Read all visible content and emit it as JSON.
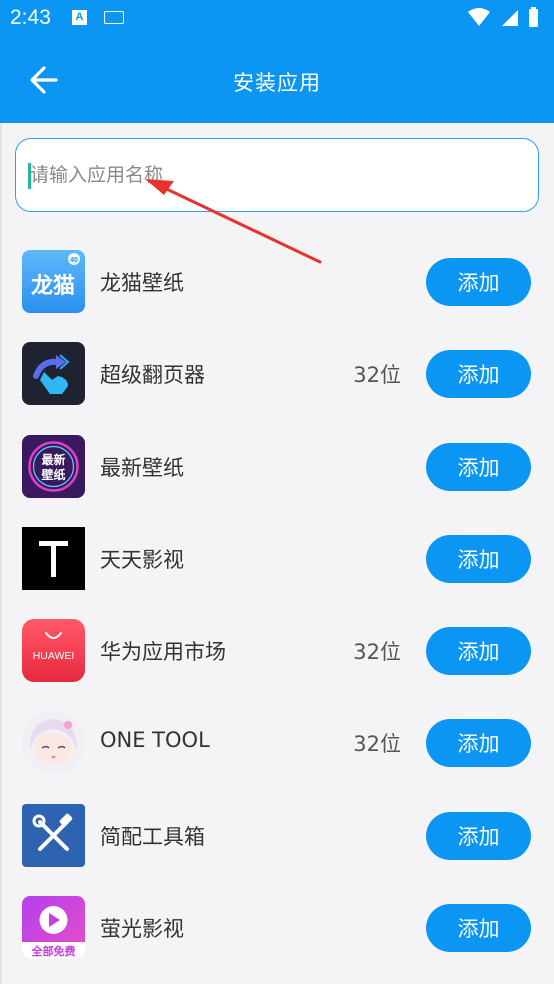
{
  "status_bar": {
    "time": "2:43",
    "notification_letter": "A"
  },
  "app_bar": {
    "title": "安装应用"
  },
  "search": {
    "placeholder": "请输入应用名称"
  },
  "apps": [
    {
      "name": "龙猫壁纸",
      "count": "",
      "button": "添加",
      "icon": "longmao-icon",
      "icon_text": "龙猫"
    },
    {
      "name": "超级翻页器",
      "count": "32位",
      "button": "添加",
      "icon": "page-flip-icon",
      "icon_text": ""
    },
    {
      "name": "最新壁纸",
      "count": "",
      "button": "添加",
      "icon": "wallpaper-icon",
      "icon_text": "最新壁纸"
    },
    {
      "name": "天天影视",
      "count": "",
      "button": "添加",
      "icon": "tiantian-icon",
      "icon_text": "T"
    },
    {
      "name": "华为应用市场",
      "count": "32位",
      "button": "添加",
      "icon": "huawei-icon",
      "icon_text": "HUAWEI"
    },
    {
      "name": "ONE TOOL",
      "count": "32位",
      "button": "添加",
      "icon": "anime-avatar-icon",
      "icon_text": ""
    },
    {
      "name": "简配工具箱",
      "count": "",
      "button": "添加",
      "icon": "tools-icon",
      "icon_text": ""
    },
    {
      "name": "萤光影视",
      "count": "",
      "button": "添加",
      "icon": "play-icon",
      "icon_text": "全部免费"
    }
  ]
}
